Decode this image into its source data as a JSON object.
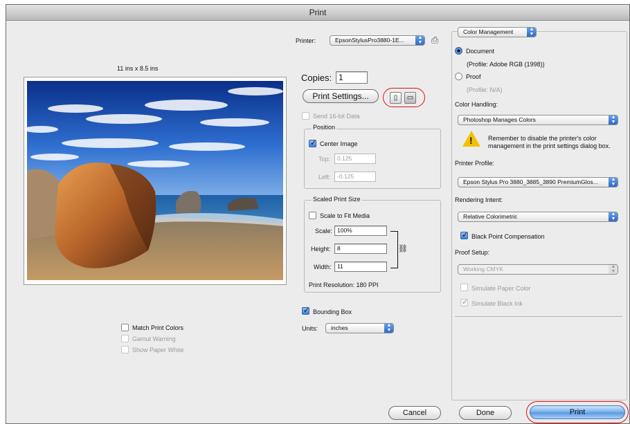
{
  "window": {
    "title": "Print"
  },
  "printer": {
    "label": "Printer:",
    "value": "EpsonStylusPro3880-1E..."
  },
  "preview": {
    "size_label": "11 ins x 8.5 ins"
  },
  "copies": {
    "label": "Copies:",
    "value": "1"
  },
  "print_settings_button": "Print Settings...",
  "send16bit": {
    "label": "Send 16-bit Data",
    "checked": false,
    "enabled": false
  },
  "position": {
    "title": "Position",
    "center_image": {
      "label": "Center Image",
      "checked": true
    },
    "top_label": "Top:",
    "top_value": "0.125",
    "left_label": "Left:",
    "left_value": "-0.125"
  },
  "scaled": {
    "title": "Scaled Print Size",
    "scale_to_fit": {
      "label": "Scale to Fit Media",
      "checked": false
    },
    "scale_label": "Scale:",
    "scale_value": "100%",
    "height_label": "Height:",
    "height_value": "8",
    "width_label": "Width:",
    "width_value": "11",
    "resolution": "Print Resolution: 180 PPI"
  },
  "bounding_box": {
    "label": "Bounding Box",
    "checked": true
  },
  "units": {
    "label": "Units:",
    "value": "inches"
  },
  "left_options": {
    "match_print_colors": {
      "label": "Match Print Colors",
      "checked": false
    },
    "gamut_warning": {
      "label": "Gamut Warning",
      "checked": false,
      "enabled": false
    },
    "show_paper_white": {
      "label": "Show Paper White",
      "checked": false,
      "enabled": false
    }
  },
  "color_mgmt": {
    "section_popup": "Color Management",
    "document_label": "Document",
    "document_profile": "(Profile: Adobe RGB (1998))",
    "proof_label": "Proof",
    "proof_profile": "(Profile: N/A)",
    "color_handling_label": "Color Handling:",
    "color_handling_value": "Photoshop Manages Colors",
    "warning_text": "Remember to disable the printer's color management in the print settings dialog box.",
    "printer_profile_label": "Printer Profile:",
    "printer_profile_value": "Epson Stylus Pro 3880_3885_3890 PremiumGlos...",
    "rendering_intent_label": "Rendering Intent:",
    "rendering_intent_value": "Relative Colorimetric",
    "black_point": {
      "label": "Black Point Compensation",
      "checked": true
    },
    "proof_setup_label": "Proof Setup:",
    "proof_setup_value": "Working CMYK",
    "simulate_paper": {
      "label": "Simulate Paper Color",
      "checked": false
    },
    "simulate_black": {
      "label": "Simulate Black Ink",
      "checked": true
    }
  },
  "buttons": {
    "cancel": "Cancel",
    "done": "Done",
    "print": "Print"
  },
  "colors": {
    "accent": "#3d7ed8",
    "highlight_ring": "#dd1111",
    "warning": "#f2c200"
  }
}
